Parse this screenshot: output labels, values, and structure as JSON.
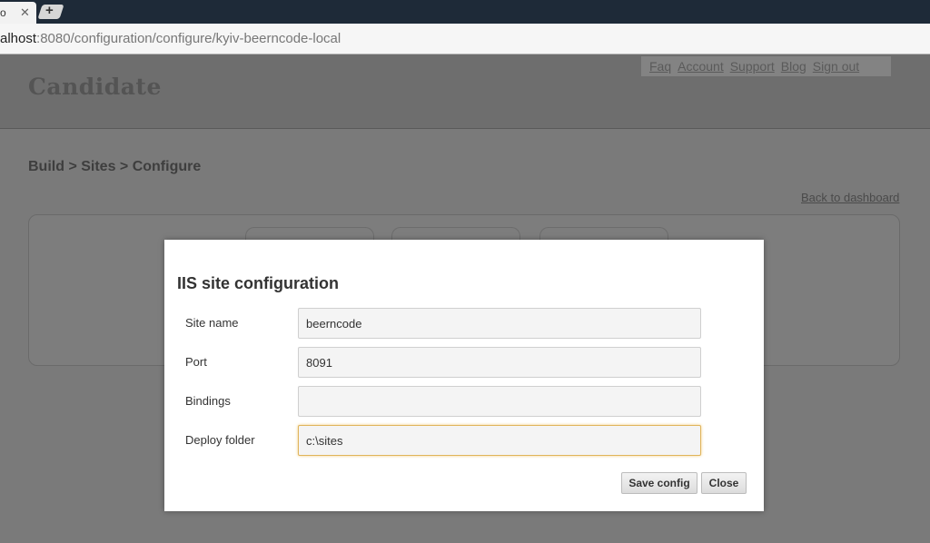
{
  "browser": {
    "tab_fragment": "o",
    "tab_close_glyph": "✕",
    "new_tab_glyph": "+",
    "url_host": "alhost",
    "url_rest": ":8080/configuration/configure/kyiv-beerncode-local"
  },
  "header": {
    "logo": "Candidate",
    "nav": [
      "Faq",
      "Account",
      "Support",
      "Blog",
      "Sign out"
    ]
  },
  "breadcrumb": "Build > Sites > Configure",
  "back_link": "Back to dashboard",
  "modal": {
    "title": "IIS site configuration",
    "fields": [
      {
        "label": "Site name",
        "value": "beerncode"
      },
      {
        "label": "Port",
        "value": "8091"
      },
      {
        "label": "Bindings",
        "value": ""
      },
      {
        "label": "Deploy folder",
        "value": "c:\\sites"
      }
    ],
    "save_label": "Save config",
    "close_label": "Close"
  },
  "colors": {
    "focus_border": "#e0b45a",
    "overlay": "#7a7a7a"
  }
}
